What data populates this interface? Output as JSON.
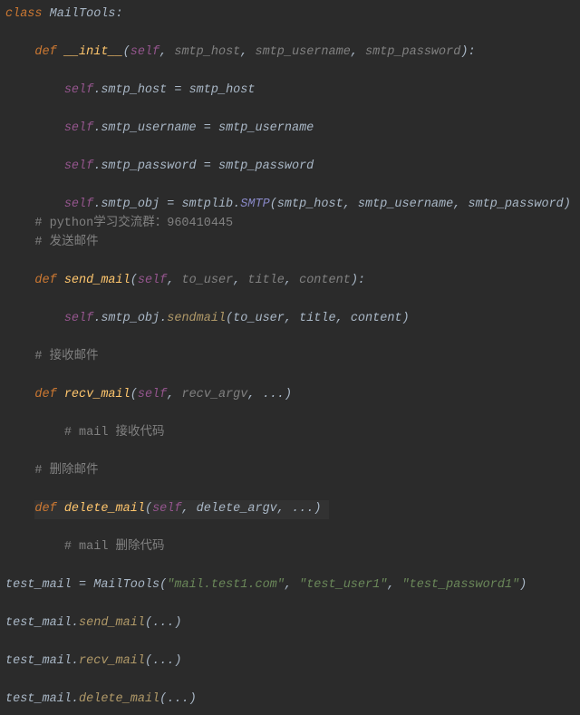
{
  "lines": {
    "class_kw": "class",
    "class_name": "MailTools",
    "def_kw": "def",
    "init_name": "__init__",
    "self": "self",
    "p_smtp_host": "smtp_host",
    "p_smtp_username": "smtp_username",
    "p_smtp_password": "smtp_password",
    "attr_smtp_host": "smtp_host",
    "attr_smtp_username": "smtp_username",
    "attr_smtp_password": "smtp_password",
    "attr_smtp_obj": "smtp_obj",
    "smtplib": "smtplib",
    "SMTP": "SMTP",
    "cmt_group": "# python学习交流群：960410445",
    "cmt_send": "# 发送邮件",
    "send_mail": "send_mail",
    "p_to_user": "to_user",
    "p_title": "title",
    "p_content": "content",
    "sendmail": "sendmail",
    "cmt_recv": "# 接收邮件",
    "recv_mail": "recv_mail",
    "p_recv_argv": "recv_argv",
    "cmt_mail_recv_code": "# mail 接收代码",
    "cmt_delete": "# 删除邮件",
    "delete_mail": "delete_mail",
    "p_delete_argv": "delete_argv",
    "cmt_mail_del_code": "# mail 删除代码",
    "test_mail": "test_mail",
    "MailTools": "MailTools",
    "str_host": "\"mail.test1.com\"",
    "str_user": "\"test_user1\"",
    "str_pw": "\"test_password1\"",
    "ellipsis": "..."
  }
}
